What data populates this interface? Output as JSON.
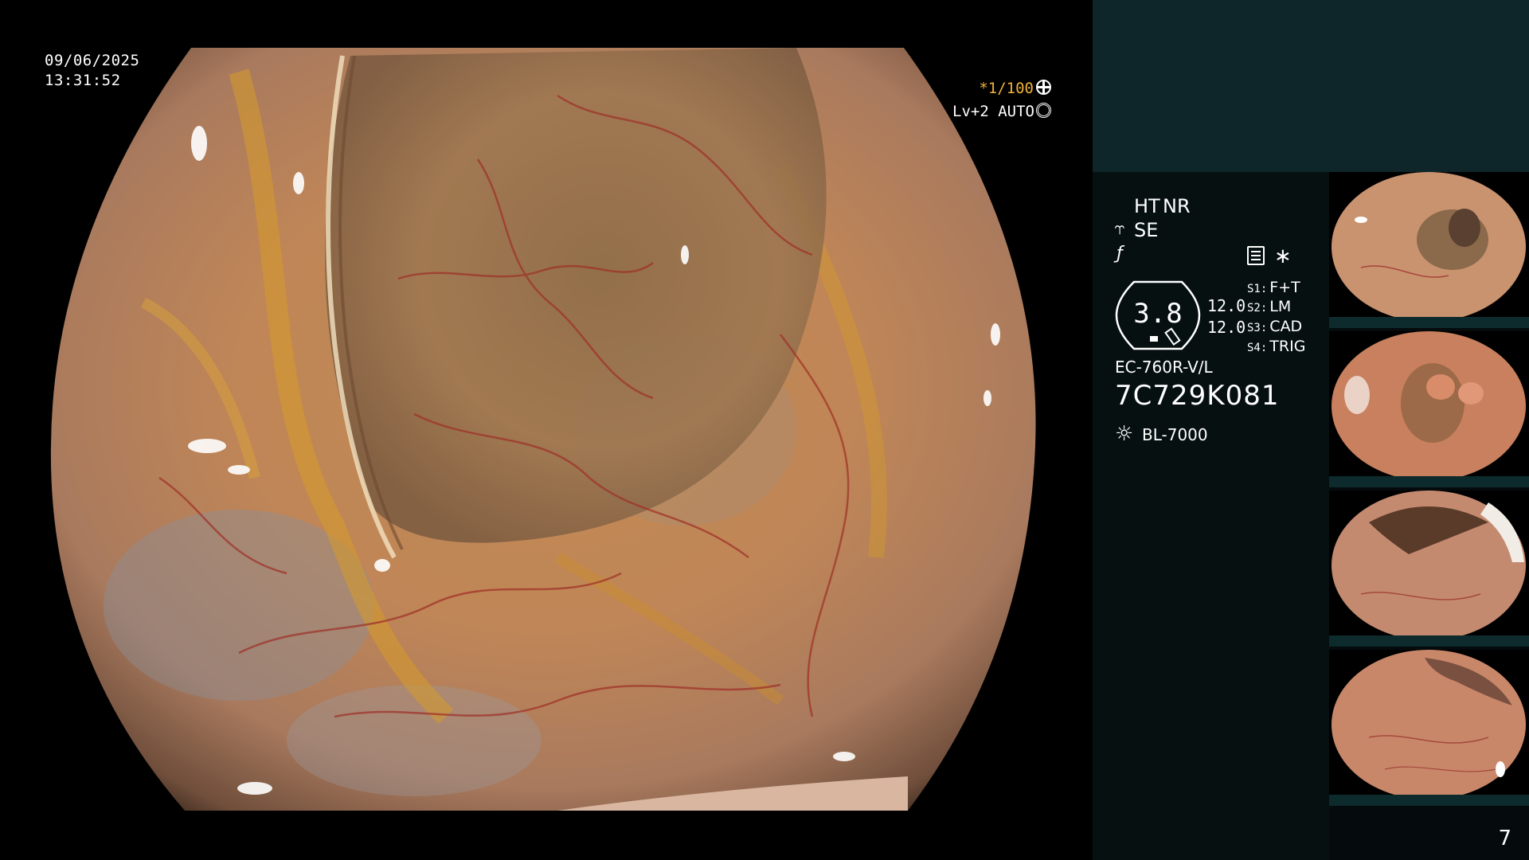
{
  "scope_view": {
    "date": "09/06/2025",
    "time": "13:31:52",
    "shutter": "*1/100",
    "iris_mode": "Lv+2 AUTO"
  },
  "side_panel": {
    "mode_ht": "HT",
    "mode_nr": "NR",
    "mode_se": "SE",
    "scope_value": "3.8",
    "value_a": "12.0",
    "value_b": "12.0",
    "switches": [
      {
        "key": "S1:",
        "value": "F+T"
      },
      {
        "key": "S2:",
        "value": "LM"
      },
      {
        "key": "S3:",
        "value": "CAD"
      },
      {
        "key": "S4:",
        "value": "TRIG"
      }
    ],
    "scope_model": "EC-760R-V/L",
    "scope_serial": "7C729K081",
    "light_source": "BL-7000",
    "page_number": "7"
  },
  "icons": {
    "se_icon": "fish-icon",
    "freeze_icon": "freeze-icon",
    "settings_icon": "list-settings-icon",
    "asterisk_icon": "asterisk-icon",
    "light_icon": "sun-icon"
  },
  "colors": {
    "accent_amber": "#f0b13a",
    "panel_teal": "#0e2629"
  }
}
